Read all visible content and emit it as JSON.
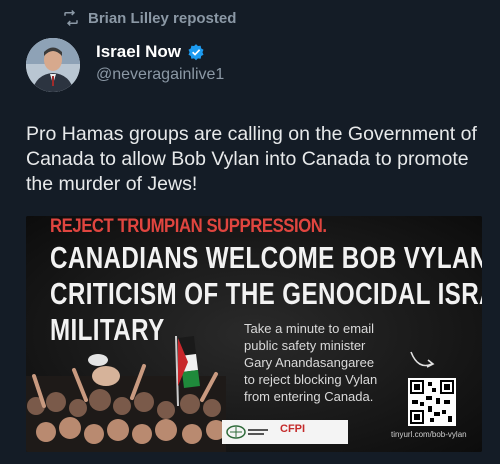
{
  "repost": {
    "icon": "repost-icon",
    "text": "Brian Lilley reposted"
  },
  "author": {
    "name": "Israel Now",
    "handle": "@neveragainlive1",
    "verified_icon": "verified-badge-icon"
  },
  "tweet": {
    "text": "Pro Hamas groups are calling on the Government of Canada to allow Bob Vylan into Canada to promote the murder of Jews!"
  },
  "media": {
    "headline_red": "REJECT TRUMPIAN SUPPRESSION.",
    "headline_lines": [
      "CANADIANS WELCOME BOB VYLAN’S",
      "CRITICISM OF THE GENOCIDAL ISRAELI",
      "MILITARY"
    ],
    "body": "Take a minute to email public safety minister Gary Anandasangaree to reject blocking Vylan from entering Canada.",
    "url": "tinyurl.com/bob-vylan",
    "logo_text": "CFPI"
  },
  "colors": {
    "background": "#141c26",
    "accent_red": "#e0453f",
    "verified_blue": "#1d9bf0"
  }
}
